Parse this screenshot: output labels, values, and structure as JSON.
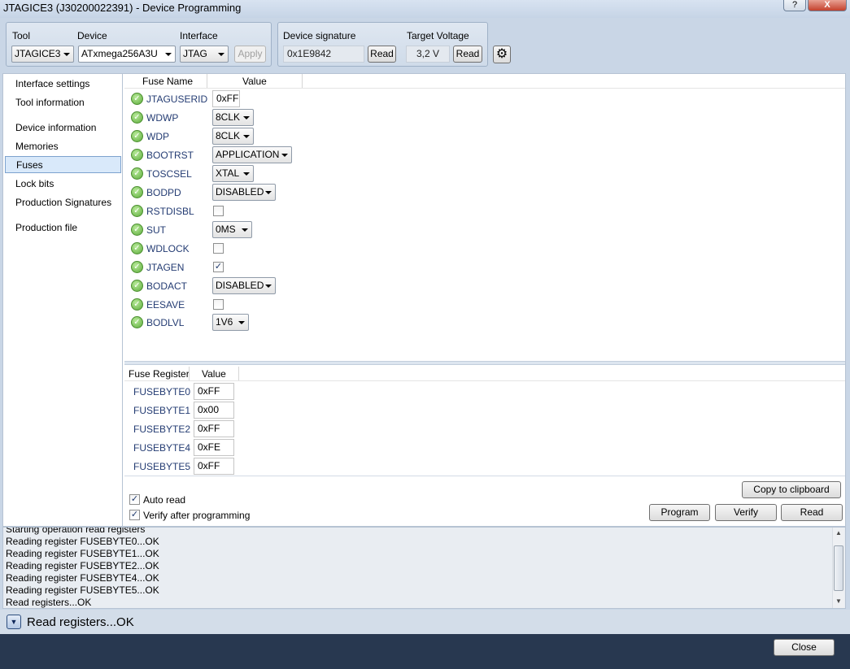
{
  "window": {
    "title": "JTAGICE3 (J30200022391) - Device Programming",
    "help_label": "?",
    "close_label": "X"
  },
  "toolbar": {
    "tool_label": "Tool",
    "tool_value": "JTAGICE3",
    "device_label": "Device",
    "device_value": "ATxmega256A3U",
    "interface_label": "Interface",
    "interface_value": "JTAG",
    "apply_label": "Apply",
    "signature_label": "Device signature",
    "signature_value": "0x1E9842",
    "signature_read": "Read",
    "voltage_label": "Target Voltage",
    "voltage_value": "3,2 V",
    "voltage_read": "Read",
    "settings_icon": "gear-icon"
  },
  "sidebar": {
    "items": [
      {
        "label": "Interface settings"
      },
      {
        "label": "Tool information"
      },
      {
        "label": "Device information"
      },
      {
        "label": "Memories"
      },
      {
        "label": "Fuses"
      },
      {
        "label": "Lock bits"
      },
      {
        "label": "Production Signatures"
      },
      {
        "label": "Production file"
      }
    ],
    "selected": "Fuses"
  },
  "fuses": {
    "col_name": "Fuse Name",
    "col_value": "Value",
    "rows": [
      {
        "name": "JTAGUSERID",
        "kind": "text",
        "value": "0xFF"
      },
      {
        "name": "WDWP",
        "kind": "combo",
        "value": "8CLK"
      },
      {
        "name": "WDP",
        "kind": "combo",
        "value": "8CLK"
      },
      {
        "name": "BOOTRST",
        "kind": "combo",
        "value": "APPLICATION"
      },
      {
        "name": "TOSCSEL",
        "kind": "combo",
        "value": "XTAL"
      },
      {
        "name": "BODPD",
        "kind": "combo",
        "value": "DISABLED"
      },
      {
        "name": "RSTDISBL",
        "kind": "check",
        "value": false
      },
      {
        "name": "SUT",
        "kind": "combo",
        "value": "0MS"
      },
      {
        "name": "WDLOCK",
        "kind": "check",
        "value": false
      },
      {
        "name": "JTAGEN",
        "kind": "check",
        "value": true
      },
      {
        "name": "BODACT",
        "kind": "combo",
        "value": "DISABLED"
      },
      {
        "name": "EESAVE",
        "kind": "check",
        "value": false
      },
      {
        "name": "BODLVL",
        "kind": "combo",
        "value": "1V6"
      }
    ]
  },
  "registers": {
    "col_name": "Fuse Register",
    "col_value": "Value",
    "rows": [
      {
        "name": "FUSEBYTE0",
        "value": "0xFF"
      },
      {
        "name": "FUSEBYTE1",
        "value": "0x00"
      },
      {
        "name": "FUSEBYTE2",
        "value": "0xFF"
      },
      {
        "name": "FUSEBYTE4",
        "value": "0xFE"
      },
      {
        "name": "FUSEBYTE5",
        "value": "0xFF"
      }
    ]
  },
  "options": {
    "auto_read_label": "Auto read",
    "auto_read": true,
    "verify_label": "Verify after programming",
    "verify": true
  },
  "actions": {
    "copy_label": "Copy to clipboard",
    "program_label": "Program",
    "verify_label": "Verify",
    "read_label": "Read"
  },
  "log": {
    "lines": [
      "Starting operation read registers",
      "Reading register FUSEBYTE0...OK",
      "Reading register FUSEBYTE1...OK",
      "Reading register FUSEBYTE2...OK",
      "Reading register FUSEBYTE4...OK",
      "Reading register FUSEBYTE5...OK",
      "Read registers...OK"
    ]
  },
  "status": {
    "text": "Read registers...OK"
  },
  "footer": {
    "close_label": "Close"
  }
}
